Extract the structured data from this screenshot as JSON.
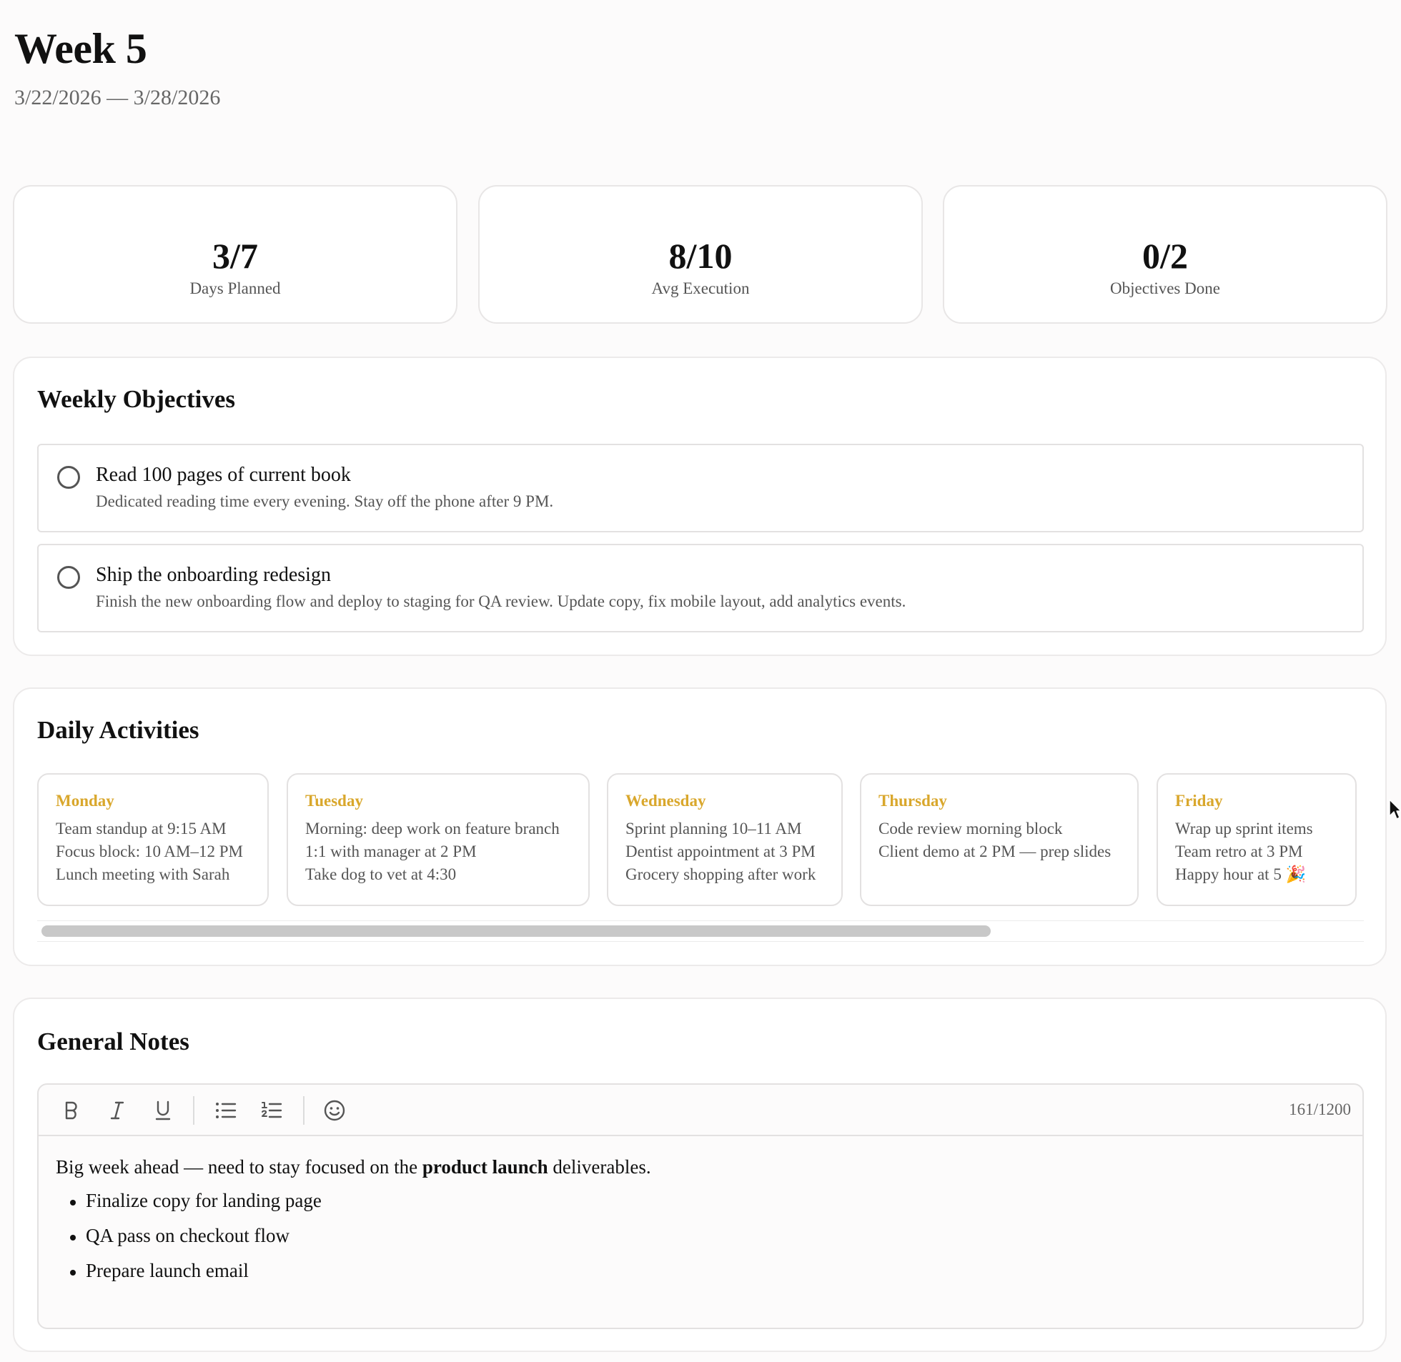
{
  "header": {
    "title": "Week 5",
    "date_start": "3/22/2026",
    "date_sep": "—",
    "date_end": "3/28/2026"
  },
  "stats": [
    {
      "value": "3/7",
      "label": "Days Planned"
    },
    {
      "value": "8/10",
      "label": "Avg Execution"
    },
    {
      "value": "0/2",
      "label": "Objectives Done"
    }
  ],
  "objectives": {
    "title": "Weekly Objectives",
    "items": [
      {
        "title": "Read 100 pages of current book",
        "description": "Dedicated reading time every evening. Stay off the phone after 9 PM.",
        "done": false
      },
      {
        "title": "Ship the onboarding redesign",
        "description": "Finish the new onboarding flow and deploy to staging for QA review. Update copy, fix mobile layout, add analytics events.",
        "done": false
      }
    ]
  },
  "daily": {
    "title": "Daily Activities",
    "days": [
      {
        "name": "Monday",
        "lines": [
          "Team standup at 9:15 AM",
          "Focus block: 10 AM–12 PM",
          "Lunch meeting with Sarah"
        ]
      },
      {
        "name": "Tuesday",
        "lines": [
          "Morning: deep work on feature branch",
          "1:1 with manager at 2 PM",
          "Take dog to vet at 4:30"
        ]
      },
      {
        "name": "Wednesday",
        "lines": [
          "Sprint planning 10–11 AM",
          "Dentist appointment at 3 PM",
          "Grocery shopping after work"
        ]
      },
      {
        "name": "Thursday",
        "lines": [
          "Code review morning block",
          "Client demo at 2 PM — prep slides"
        ]
      },
      {
        "name": "Friday",
        "lines": [
          "Wrap up sprint items",
          "Team retro at 3 PM",
          "Happy hour at 5 🎉"
        ]
      }
    ]
  },
  "notes": {
    "title": "General Notes",
    "char_count": "161/1200",
    "toolbar": [
      "bold-icon",
      "italic-icon",
      "underline-icon",
      "bullet-list-icon",
      "numbered-list-icon",
      "emoji-icon"
    ],
    "intro_before": "Big week ahead — need to stay focused on the ",
    "intro_bold": "product launch",
    "intro_after": " deliverables.",
    "bullets": [
      "Finalize copy for landing page",
      "QA pass on checkout flow",
      "Prepare launch email"
    ]
  },
  "colors": {
    "day_accent": "#d9a72c",
    "background": "#fcfbfb",
    "border": "#e3e1e1"
  }
}
